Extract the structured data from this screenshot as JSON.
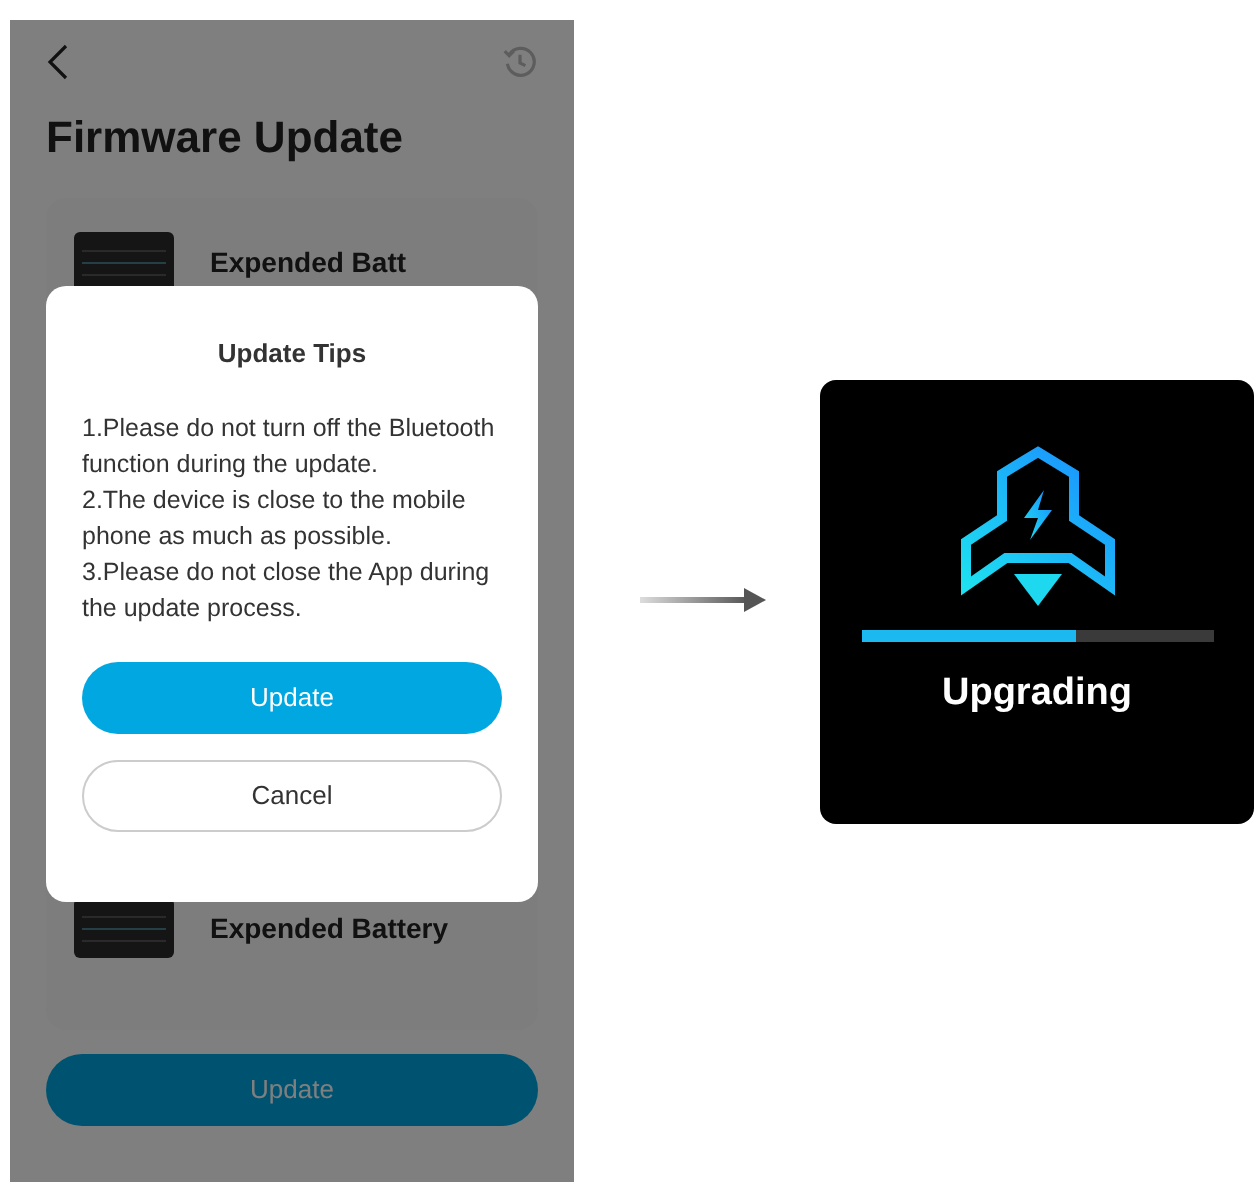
{
  "phone": {
    "title": "Firmware Update",
    "devices": [
      {
        "name": "Expended Batt"
      },
      {
        "name": "Expended Battery"
      }
    ],
    "update_button": "Update"
  },
  "dialog": {
    "title": "Update Tips",
    "lines": [
      "1.Please do not turn off the Bluetooth function during the update.",
      "2.The device is close to the mobile phone as much as possible.",
      "3.Please do not close the App during the update process."
    ],
    "buttons": [
      {
        "kind": "primary",
        "label": "Update"
      },
      {
        "kind": "secondary",
        "label": "Cancel"
      }
    ]
  },
  "device_screen": {
    "progress": {
      "level": 0.61
    },
    "status": "Upgrading"
  }
}
